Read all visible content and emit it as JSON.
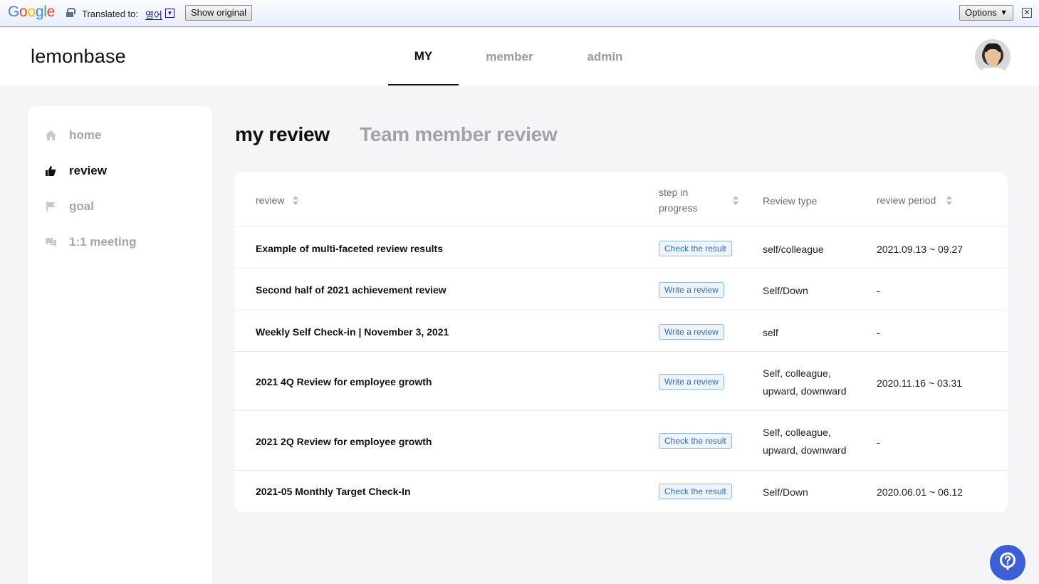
{
  "translate_bar": {
    "logo_letters": [
      "G",
      "o",
      "o",
      "g",
      "l",
      "e"
    ],
    "logo_colors": [
      "#4285f4",
      "#ea4335",
      "#fbbc05",
      "#4285f4",
      "#34a853",
      "#ea4335"
    ],
    "translated_to_label": "Translated to:",
    "language": "영어",
    "show_original_label": "Show original",
    "options_label": "Options",
    "options_arrow": "▼",
    "close_glyph": "✕"
  },
  "header": {
    "brand": "lemonbase",
    "nav": [
      {
        "label": "MY",
        "active": true
      },
      {
        "label": "member",
        "active": false
      },
      {
        "label": "admin",
        "active": false
      }
    ]
  },
  "sidebar": {
    "items": [
      {
        "label": "home",
        "icon": "home-icon",
        "active": false
      },
      {
        "label": "review",
        "icon": "thumbs-up-icon",
        "active": true
      },
      {
        "label": "goal",
        "icon": "flag-icon",
        "active": false
      },
      {
        "label": "1:1 meeting",
        "icon": "chat-icon",
        "active": false
      }
    ]
  },
  "main": {
    "tabs": [
      {
        "label": "my review",
        "active": true
      },
      {
        "label": "Team member review",
        "active": false
      }
    ],
    "table": {
      "headers": {
        "review": "review",
        "step_line1": "step in",
        "step_line2": "progress",
        "type": "Review type",
        "period": "review period"
      },
      "rows": [
        {
          "title": "Example of multi-faceted review results",
          "step": "Check the result",
          "type_line1": "self/colleague",
          "type_line2": "",
          "period": "2021.09.13 ~ 09.27"
        },
        {
          "title": "Second half of 2021 achievement review",
          "step": "Write a review",
          "type_line1": "Self/Down",
          "type_line2": "",
          "period": "-"
        },
        {
          "title": "Weekly Self Check-in | November 3, 2021",
          "step": "Write a review",
          "type_line1": "self",
          "type_line2": "",
          "period": "-"
        },
        {
          "title": "2021 4Q Review for employee growth",
          "step": "Write a review",
          "type_line1": "Self, colleague,",
          "type_line2": "upward, downward",
          "period": "2020.11.16 ~ 03.31"
        },
        {
          "title": "2021 2Q Review for employee growth",
          "step": "Check the result",
          "type_line1": "Self, colleague,",
          "type_line2": "upward, downward",
          "period": "-"
        },
        {
          "title": "2021-05 Monthly Target Check-In",
          "step": "Check the result",
          "type_line1": "Self/Down",
          "type_line2": "",
          "period": "2020.06.01 ~ 06.12"
        }
      ]
    }
  },
  "help_button": {
    "icon": "question-icon"
  },
  "colors": {
    "accent": "#3c5fd4",
    "badge_border": "#8fb4e6",
    "badge_text": "#2f6dc4",
    "page_bg": "#f5f5f7"
  }
}
